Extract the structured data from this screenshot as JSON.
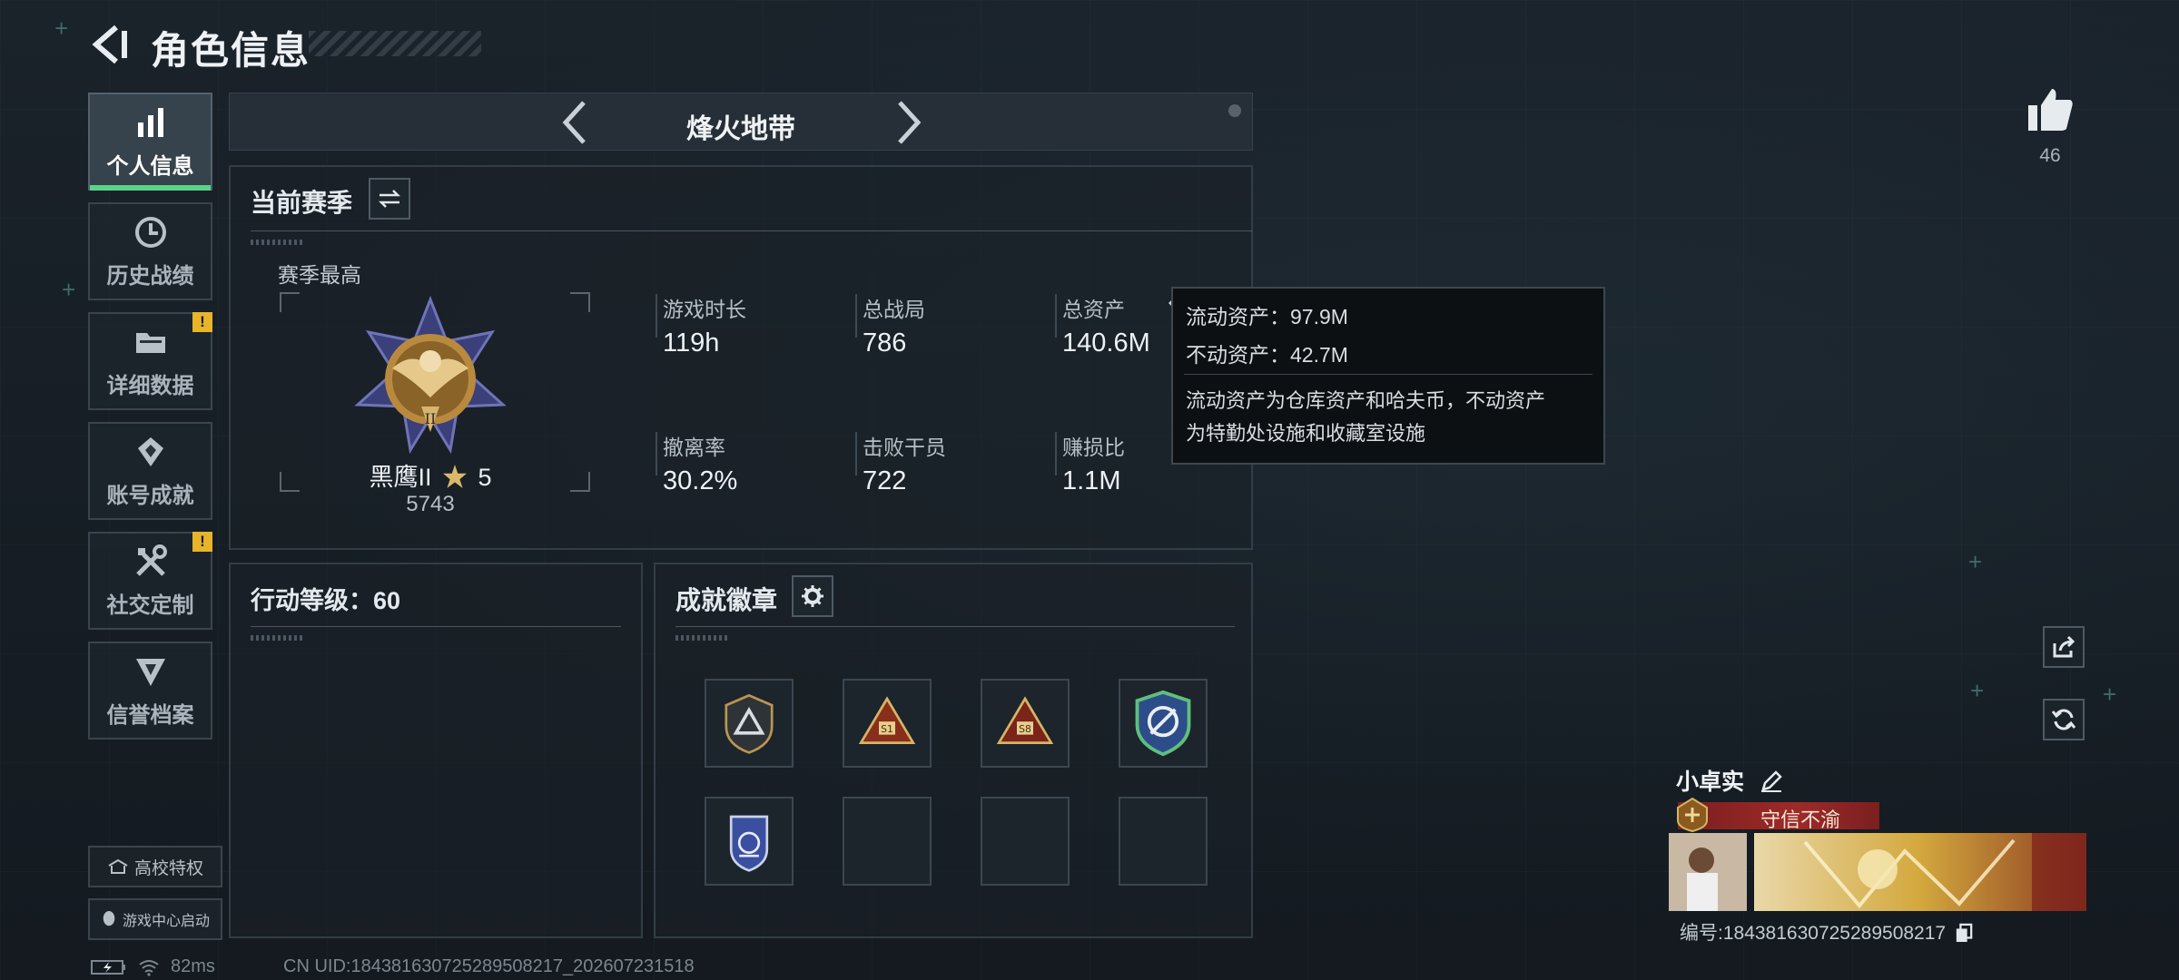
{
  "header": {
    "title": "角色信息"
  },
  "sidebar": {
    "items": [
      {
        "label": "个人信息",
        "icon": "bar-chart-icon",
        "active": true
      },
      {
        "label": "历史战绩",
        "icon": "clock-icon"
      },
      {
        "label": "详细数据",
        "icon": "folder-icon",
        "alert": "!"
      },
      {
        "label": "账号成就",
        "icon": "achievement-icon"
      },
      {
        "label": "社交定制",
        "icon": "tools-icon",
        "alert": "!"
      },
      {
        "label": "信誉档案",
        "icon": "reputation-icon"
      }
    ],
    "campus_privilege": "高校特权",
    "game_center_launch": "游戏中心启动"
  },
  "mode_nav": {
    "title": "烽火地带"
  },
  "season": {
    "section_title": "当前赛季",
    "best_label": "赛季最高",
    "rank_name": "黑鹰II",
    "rank_stars": "5",
    "rank_score": "5743",
    "stats": [
      {
        "label": "游戏时长",
        "value": "119h"
      },
      {
        "label": "总战局",
        "value": "786"
      },
      {
        "label": "总资产",
        "value": "140.6M"
      },
      {
        "label": "撤离率",
        "value": "30.2%"
      },
      {
        "label": "击败干员",
        "value": "722"
      },
      {
        "label": "赚损比",
        "value": "1.1M"
      }
    ]
  },
  "tooltip": {
    "liquid": "流动资产：97.9M",
    "fixed": "不动资产：42.7M",
    "desc_line1": "流动资产为仓库资产和哈夫币，不动资产",
    "desc_line2": "为特勤处设施和收藏室设施"
  },
  "action_level": {
    "title": "行动等级：60"
  },
  "badges": {
    "title": "成就徽章",
    "slot_badges": [
      "shield-triangle-badge",
      "gold-triangle-s1-badge",
      "gold-triangle-s8-badge",
      "green-emblem-badge",
      "blue-shield-badge",
      "",
      "",
      ""
    ]
  },
  "likes": {
    "count": "46"
  },
  "player": {
    "name": "小卓实",
    "title_banner": "守信不渝",
    "id_text": "编号:184381630725289508217"
  },
  "status": {
    "ping": "82ms",
    "uid": "CN UID:184381630725289508217_202607231518"
  },
  "colors": {
    "accent_green": "#59d58a",
    "alert_yellow": "#e8b429",
    "banner_red": "#9e2a28"
  }
}
